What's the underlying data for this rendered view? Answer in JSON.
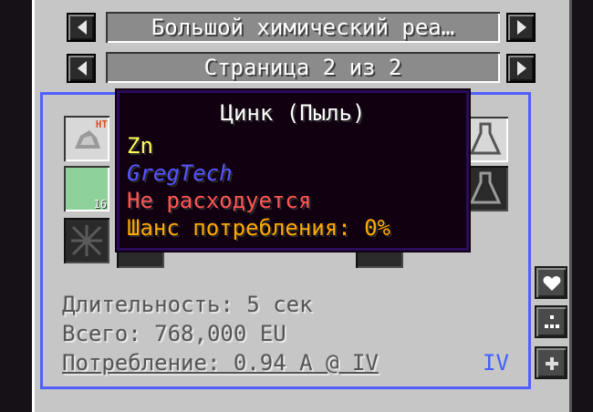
{
  "header": {
    "machine_name": "Большой химический реа…",
    "page_label": "Страница 2 из 2"
  },
  "slots": {
    "hot_tag": "HT",
    "green_count": "16"
  },
  "recipe_info": {
    "duration": "Длительность: 5 сек",
    "total": "Всего: 768,000 EU",
    "usage": "Потребление: 0.94 A @ IV",
    "tier": "IV"
  },
  "tooltip": {
    "title": "Цинк (Пыль)",
    "formula": "Zn",
    "mod": "GregTech",
    "not_consumed": "Не расходуется",
    "chance": "Шанс потребления: 0%"
  },
  "colors": {
    "formula": "#ffff55",
    "mod": "#5555ff",
    "not_consumed": "#ff5555",
    "chance": "#ffaa00",
    "tier": "#4060ff",
    "frame": "#5060ff"
  },
  "side_buttons": [
    "heart-icon",
    "dots-icon",
    "plus-icon"
  ]
}
